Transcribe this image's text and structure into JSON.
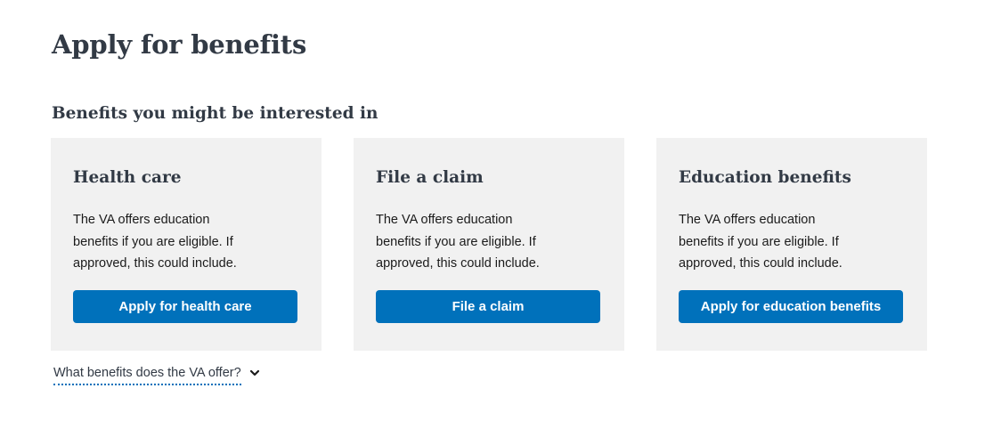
{
  "page": {
    "title": "Apply for benefits"
  },
  "section": {
    "heading": "Benefits you might be interested in"
  },
  "cards": [
    {
      "title": "Health care",
      "description": "The VA offers education benefits if you are eligible. If approved, this could include.",
      "button_label": "Apply for health care"
    },
    {
      "title": "File a claim",
      "description": "The VA offers education benefits if you are eligible. If approved, this could include.",
      "button_label": "File a claim"
    },
    {
      "title": "Education benefits",
      "description": "The VA offers education benefits if you are eligible. If approved, this could include.",
      "button_label": "Apply for education benefits"
    }
  ],
  "disclosure": {
    "label": "What benefits does the VA offer?",
    "icon": "chevron-down-icon"
  },
  "colors": {
    "primary_button": "#0071bb",
    "card_background": "#f1f1f1",
    "heading_text": "#323a45"
  }
}
